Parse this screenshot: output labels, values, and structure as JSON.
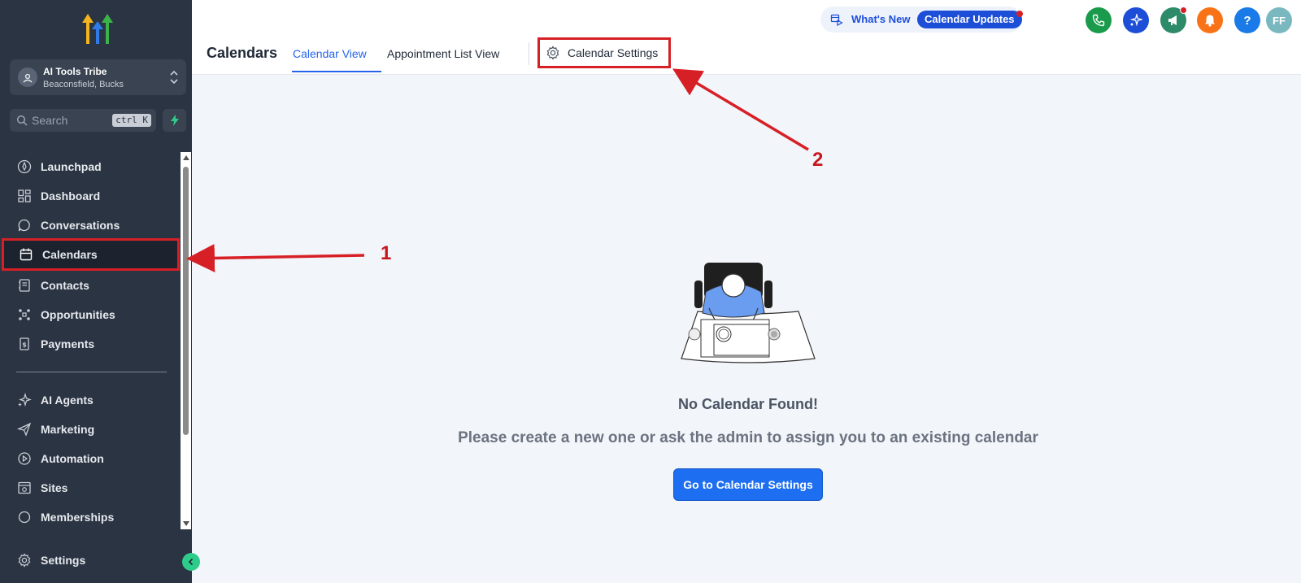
{
  "sidebar": {
    "account": {
      "name": "AI Tools Tribe",
      "location": "Beaconsfield, Bucks"
    },
    "search": {
      "placeholder": "Search",
      "shortcut": "ctrl K"
    },
    "items": [
      {
        "label": "Launchpad",
        "icon": "rocket-icon"
      },
      {
        "label": "Dashboard",
        "icon": "grid-icon"
      },
      {
        "label": "Conversations",
        "icon": "chat-icon"
      },
      {
        "label": "Calendars",
        "icon": "calendar-icon",
        "active": true
      },
      {
        "label": "Contacts",
        "icon": "contacts-icon"
      },
      {
        "label": "Opportunities",
        "icon": "opportunities-icon"
      },
      {
        "label": "Payments",
        "icon": "payments-icon"
      },
      {
        "label": "AI Agents",
        "icon": "sparkle-icon"
      },
      {
        "label": "Marketing",
        "icon": "send-icon"
      },
      {
        "label": "Automation",
        "icon": "automation-icon"
      },
      {
        "label": "Sites",
        "icon": "sites-icon"
      },
      {
        "label": "Memberships",
        "icon": "memberships-icon"
      }
    ],
    "settings_label": "Settings"
  },
  "header": {
    "title": "Calendars",
    "tabs": [
      {
        "label": "Calendar View",
        "active": true
      },
      {
        "label": "Appointment List View",
        "active": false
      },
      {
        "label": "Calendar Settings",
        "active": false
      }
    ],
    "whats_new": {
      "label": "What's New",
      "pill": "Calendar Updates"
    },
    "user_initials": "FF"
  },
  "main": {
    "empty_title": "No Calendar Found!",
    "empty_message": "Please create a new one or ask the admin to assign you to an existing calendar",
    "cta_label": "Go to Calendar Settings"
  },
  "annotations": {
    "first": "1",
    "second": "2"
  },
  "colors": {
    "sidebar_bg": "#2b3442",
    "accent_blue": "#2563eb",
    "annotation_red": "#d72026",
    "phone_green": "#1a9a4b",
    "ai_blue": "#1d4ed8",
    "megaphone_teal": "#2e8b6a",
    "bell_orange": "#f97316",
    "help_blue": "#1a7be8",
    "avatar_teal": "#7ab8c0"
  }
}
